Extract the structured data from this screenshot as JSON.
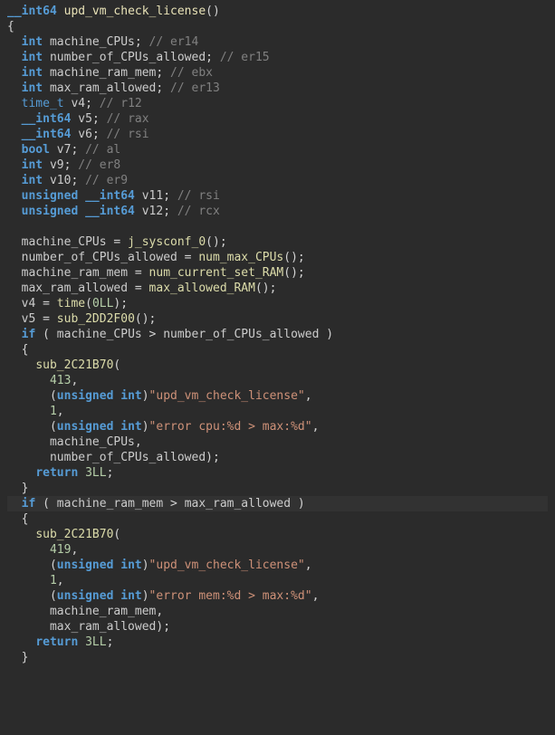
{
  "code": {
    "ret_type": "__int64",
    "fn_name": "upd_vm_check_license",
    "open_paren": "(",
    "close_paren": ")",
    "decl_int": "int",
    "decl_time_t": "time_t",
    "decl_int64": "__int64",
    "decl_bool": "bool",
    "decl_uint64": "unsigned __int64",
    "decl_unsigned_int_cast": "unsigned int",
    "v_machine_CPUs": "machine_CPUs",
    "v_number_of_CPUs_allowed": "number_of_CPUs_allowed",
    "v_machine_ram_mem": "machine_ram_mem",
    "v_max_ram_allowed": "max_ram_allowed",
    "v_v4": "v4",
    "v_v5": "v5",
    "v_v6": "v6",
    "v_v7": "v7",
    "v_v9": "v9",
    "v_v10": "v10",
    "v_v11": "v11",
    "v_v12": "v12",
    "c_decl1": "// er14",
    "c_decl2": "// er15",
    "c_decl3": "// ebx",
    "c_decl4": "// er13",
    "c_decl5": "// r12",
    "c_decl6": "// rax",
    "c_decl7": "// rsi",
    "c_decl8": "// al",
    "c_decl9": "// er8",
    "c_decl10": "// er9",
    "c_decl11": "// rsi",
    "c_decl12": "// rcx",
    "call_j_sysconf_0": "j_sysconf_0",
    "call_num_max_CPUs": "num_max_CPUs",
    "call_num_current_set_RAM": "num_current_set_RAM",
    "call_max_allowed_RAM": "max_allowed_RAM",
    "call_time": "time",
    "call_sub_2DD2F00": "sub_2DD2F00",
    "call_sub_2C21B70": "sub_2C21B70",
    "lit_0LL": "0LL",
    "lit_413": "413",
    "lit_419": "419",
    "lit_1": "1",
    "lit_3LL": "3LL",
    "str_fn_name": "\"upd_vm_check_license\"",
    "str_err_cpu": "\"error cpu:%d > max:%d\"",
    "str_err_mem": "\"error mem:%d > max:%d\"",
    "kw_if": "if",
    "kw_return": "return",
    "op_assign": " = ",
    "op_gt": " > ",
    "semi": ";",
    "comma": ",",
    "brace_open": "{",
    "brace_close": "}",
    "paren_open": "(",
    "paren_close": ")",
    "space": " "
  }
}
